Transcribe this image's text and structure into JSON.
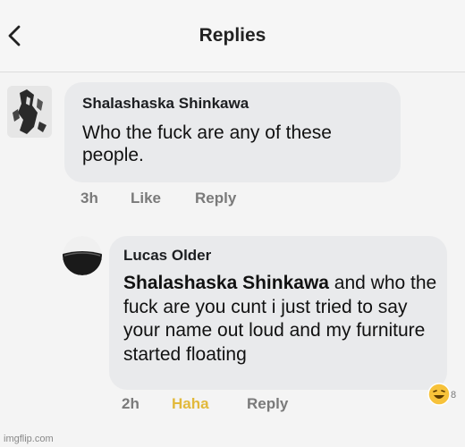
{
  "header": {
    "title": "Replies"
  },
  "comments": [
    {
      "author": "Shalashaska Shinkawa",
      "text": "Who the fuck are any of these people.",
      "time": "3h",
      "like_label": "Like",
      "reply_label": "Reply"
    },
    {
      "author": "Lucas Older",
      "mention": "Shalashaska Shinkawa",
      "text": " and who the fuck are you cunt i just tried to say your name out loud and my furniture started floating",
      "time": "2h",
      "reaction_label": "Haha",
      "reply_label": "Reply",
      "reaction_count": "8"
    }
  ],
  "watermark": "imgflip.com",
  "colors": {
    "haha": "#e2b93b",
    "bubble": "#e9eaec",
    "meta": "#7a7a7a"
  }
}
